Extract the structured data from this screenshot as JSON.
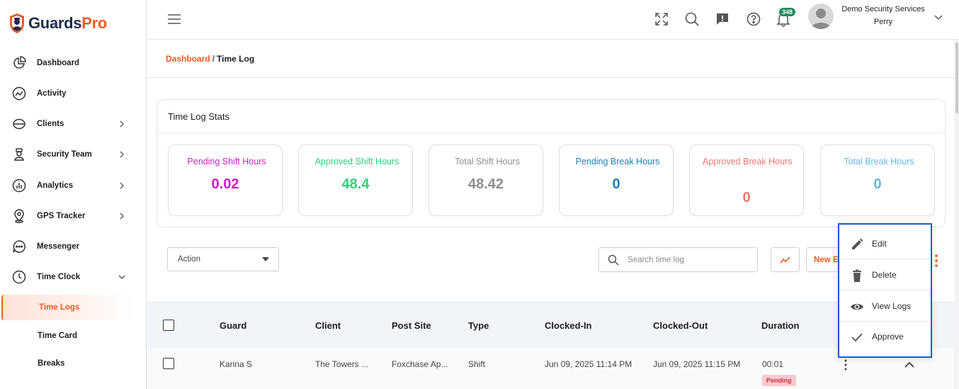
{
  "brand": {
    "part1": "Guards",
    "part2": "Pro"
  },
  "sidebar": {
    "items": [
      {
        "label": "Dashboard"
      },
      {
        "label": "Activity"
      },
      {
        "label": "Clients"
      },
      {
        "label": "Security Team"
      },
      {
        "label": "Analytics"
      },
      {
        "label": "GPS Tracker"
      },
      {
        "label": "Messenger"
      },
      {
        "label": "Time Clock"
      }
    ],
    "sub_items": [
      {
        "label": "Time Logs",
        "active": true
      },
      {
        "label": "Time Card"
      },
      {
        "label": "Breaks"
      }
    ]
  },
  "header": {
    "notifications_count": "348",
    "user_name": "Demo Security Services",
    "user_sub": "Perry"
  },
  "breadcrumb": {
    "home": "Dashboard",
    "separator": "/",
    "current": "Time Log"
  },
  "stats": {
    "title": "Time Log Stats",
    "cards": [
      {
        "label": "Pending Shift Hours",
        "value": "0.02",
        "color": "#c61fc9"
      },
      {
        "label": "Approved Shift Hours",
        "value": "48.4",
        "color": "#2fd07a"
      },
      {
        "label": "Total Shift Hours",
        "value": "48.42",
        "color": "#8e8e8e"
      },
      {
        "label": "Pending Break Hours",
        "value": "0",
        "color": "#1a7fb5"
      },
      {
        "label": "Approved Break Hours",
        "value": "0",
        "color": "#e97871"
      },
      {
        "label": "Total Break Hours",
        "value": "0",
        "color": "#63b6e6"
      }
    ]
  },
  "toolbar": {
    "action_label": "Action",
    "search_placeholder": "Search time log",
    "new_label": "New En"
  },
  "table": {
    "columns": [
      "Guard",
      "Client",
      "Post Site",
      "Type",
      "Clocked-In",
      "Clocked-Out",
      "Duration"
    ],
    "rows": [
      {
        "guard": "Karina S",
        "client": "The Towers ...",
        "post_site": "Foxchase Ap...",
        "type": "Shift",
        "clocked_in": "Jun 09, 2025 11:14 PM",
        "clocked_out": "Jun 09, 2025 11:15 PM",
        "duration": "00:01",
        "status": "Pending"
      }
    ]
  },
  "row_menu": {
    "items": [
      {
        "label": "Edit",
        "icon": "pencil-icon"
      },
      {
        "label": "Delete",
        "icon": "trash-icon"
      },
      {
        "label": "View Logs",
        "icon": "eye-icon"
      },
      {
        "label": "Approve",
        "icon": "check-icon"
      }
    ]
  },
  "colors": {
    "accent": "#f05a22",
    "navy": "#1d2a4d",
    "menu_border": "#1a5ad8"
  }
}
